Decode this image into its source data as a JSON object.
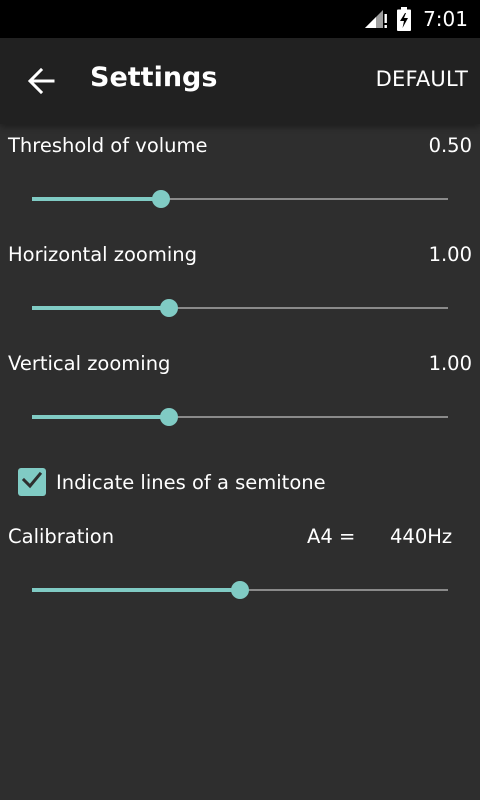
{
  "status_bar": {
    "time": "7:01",
    "icons": [
      "signal-icon",
      "battery-charging-icon"
    ]
  },
  "app_bar": {
    "back_icon": "arrow-left-icon",
    "title": "Settings",
    "default_label": "DEFAULT"
  },
  "settings": {
    "threshold": {
      "label": "Threshold of volume",
      "value": "0.50",
      "level": 0.31
    },
    "horizontal_zoom": {
      "label": "Horizontal zooming",
      "value": "1.00",
      "level": 0.33
    },
    "vertical_zoom": {
      "label": "Vertical zooming",
      "value": "1.00",
      "level": 0.33
    },
    "semitone": {
      "label": "Indicate lines of a semitone",
      "checked": true
    },
    "calibration": {
      "label": "Calibration",
      "note": "A4 =",
      "value": "440Hz",
      "level": 0.5
    }
  },
  "colors": {
    "accent": "#80cbc4",
    "background": "#2e2e2e",
    "app_bar": "#212121",
    "track": "#8a8a8a"
  }
}
